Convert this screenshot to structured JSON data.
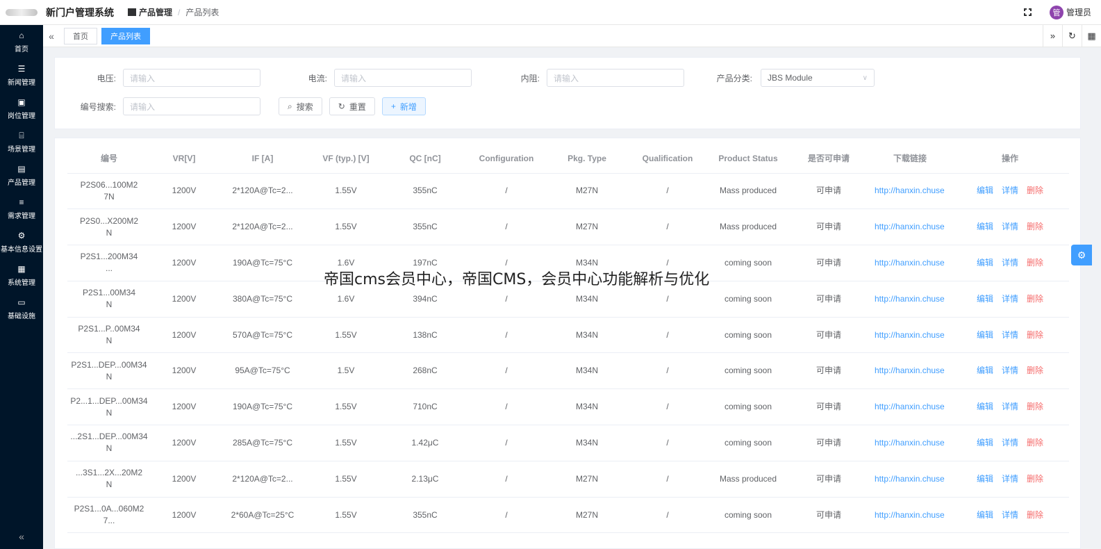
{
  "header": {
    "system_title": "新门户管理系统",
    "breadcrumb": [
      "产品管理",
      "产品列表"
    ],
    "user": {
      "avatar_text": "管",
      "name": "管理员"
    }
  },
  "sidebar": {
    "items": [
      {
        "icon": "home-icon",
        "label": "首页"
      },
      {
        "icon": "news-icon",
        "label": "新闻管理"
      },
      {
        "icon": "badge-icon",
        "label": "岗位管理"
      },
      {
        "icon": "bank-icon",
        "label": "场景管理"
      },
      {
        "icon": "box-icon",
        "label": "产品管理"
      },
      {
        "icon": "list-icon",
        "label": "需求管理"
      },
      {
        "icon": "settings-icon",
        "label": "基本信息设置"
      },
      {
        "icon": "briefcase-icon",
        "label": "系统管理"
      },
      {
        "icon": "monitor-icon",
        "label": "基础设施"
      }
    ],
    "collapse_symbol": "«"
  },
  "tabs": {
    "collapse_symbol": "«",
    "items": [
      {
        "label": "首页",
        "active": false
      },
      {
        "label": "产品列表",
        "active": true
      }
    ],
    "tools": [
      "»",
      "↻",
      "▦"
    ]
  },
  "search": {
    "voltage": {
      "label": "电压:",
      "placeholder": "请输入"
    },
    "current": {
      "label": "电流:",
      "placeholder": "请输入"
    },
    "resistance": {
      "label": "内阻:",
      "placeholder": "请输入"
    },
    "category": {
      "label": "产品分类:",
      "value": "JBS Module"
    },
    "code": {
      "label": "编号搜索:",
      "placeholder": "请输入"
    },
    "buttons": {
      "search": "搜索",
      "reset": "重置",
      "add": "新增"
    }
  },
  "table": {
    "headers": [
      "编号",
      "VR[V]",
      "IF [A]",
      "VF (typ.) [V]",
      "QC [nC]",
      "Configuration",
      "Pkg. Type",
      "Qualification",
      "Product Status",
      "是否可申请",
      "下载链接",
      "操作"
    ],
    "rows": [
      [
        "P2S06...100M2\n7N",
        "1200V",
        "2*120A@Tc=2...",
        "1.55V",
        "355nC",
        "/",
        "M27N",
        "/",
        "Mass produced",
        "可申请",
        "http://hanxin.chuse"
      ],
      [
        "P2S0...X200M2\nN",
        "1200V",
        "2*120A@Tc=2...",
        "1.55V",
        "355nC",
        "/",
        "M27N",
        "/",
        "Mass produced",
        "可申请",
        "http://hanxin.chuse"
      ],
      [
        "P2S1...200M34\n...",
        "1200V",
        "190A@Tc=75°C",
        "1.6V",
        "197nC",
        "/",
        "M34N",
        "/",
        "coming soon",
        "可申请",
        "http://hanxin.chuse"
      ],
      [
        "P2S1...00M34\nN",
        "1200V",
        "380A@Tc=75°C",
        "1.6V",
        "394nC",
        "/",
        "M34N",
        "/",
        "coming soon",
        "可申请",
        "http://hanxin.chuse"
      ],
      [
        "P2S1...P..00M34\nN",
        "1200V",
        "570A@Tc=75°C",
        "1.55V",
        "138nC",
        "/",
        "M34N",
        "/",
        "coming soon",
        "可申请",
        "http://hanxin.chuse"
      ],
      [
        "P2S1...DEP...00M34\nN",
        "1200V",
        "95A@Tc=75°C",
        "1.5V",
        "268nC",
        "/",
        "M34N",
        "/",
        "coming soon",
        "可申请",
        "http://hanxin.chuse"
      ],
      [
        "P2...1...DEP...00M34\nN",
        "1200V",
        "190A@Tc=75°C",
        "1.55V",
        "710nC",
        "/",
        "M34N",
        "/",
        "coming soon",
        "可申请",
        "http://hanxin.chuse"
      ],
      [
        "...2S1...DEP...00M34\nN",
        "1200V",
        "285A@Tc=75°C",
        "1.55V",
        "1.42μC",
        "/",
        "M34N",
        "/",
        "coming soon",
        "可申请",
        "http://hanxin.chuse"
      ],
      [
        "...3S1...2X...20M2\nN",
        "1200V",
        "2*120A@Tc=2...",
        "1.55V",
        "2.13μC",
        "/",
        "M27N",
        "/",
        "Mass produced",
        "可申请",
        "http://hanxin.chuse"
      ],
      [
        "P2S1...0A...060M2\n7...",
        "1200V",
        "2*60A@Tc=25°C",
        "1.55V",
        "355nC",
        "/",
        "M27N",
        "/",
        "coming soon",
        "可申请",
        "http://hanxin.chuse"
      ]
    ],
    "ops": {
      "edit": "编辑",
      "detail": "详情",
      "delete": "删除"
    }
  },
  "overlay_caption": "帝国cms会员中心，帝国CMS，会员中心功能解析与优化",
  "colors": {
    "sidebar_bg": "#001529",
    "primary": "#409eff",
    "danger": "#f56c6c"
  }
}
